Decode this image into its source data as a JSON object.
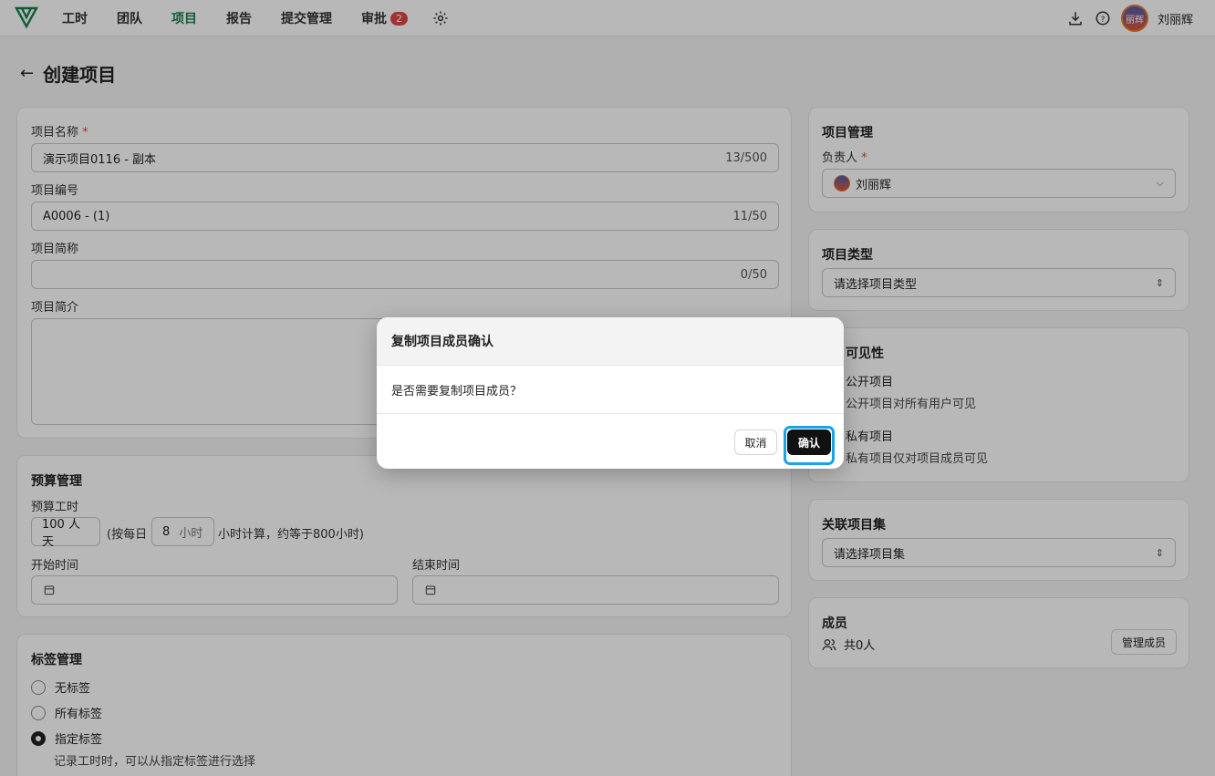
{
  "nav": {
    "items": [
      {
        "label": "工时"
      },
      {
        "label": "团队"
      },
      {
        "label": "项目"
      },
      {
        "label": "报告"
      },
      {
        "label": "提交管理"
      },
      {
        "label": "审批"
      }
    ],
    "approval_badge": "2",
    "active": "项目",
    "user_name": "刘丽辉",
    "avatar_text": "丽辉"
  },
  "page": {
    "title": "创建项目"
  },
  "basic": {
    "name_label": "项目名称",
    "name_value": "演示项目0116 - 副本",
    "name_counter": "13/500",
    "code_label": "项目编号",
    "code_value": "A0006 - (1)",
    "code_counter": "11/50",
    "short_label": "项目简称",
    "short_counter": "0/50",
    "intro_label": "项目简介"
  },
  "budget": {
    "title": "预算管理",
    "hours_label": "预算工时",
    "days_value": "100 人天",
    "per_day_prefix": "(按每日",
    "per_day_value": "8",
    "per_day_unit": "小时",
    "per_day_suffix": "小时计算，约等于800小时)",
    "start_label": "开始时间",
    "end_label": "结束时间"
  },
  "tags": {
    "title": "标签管理",
    "options": [
      "无标签",
      "所有标签",
      "指定标签"
    ],
    "hint": "记录工时时，可以从指定标签进行选择"
  },
  "management": {
    "title": "项目管理",
    "owner_label": "负责人",
    "owner_value": "刘丽辉"
  },
  "type": {
    "title": "项目类型",
    "placeholder": "请选择项目类型"
  },
  "visibility": {
    "title": "可见性",
    "public_label": "公开项目",
    "public_desc": "公开项目对所有用户可见",
    "private_label": "私有项目",
    "private_desc": "私有项目仅对项目成员可见"
  },
  "collection": {
    "title": "关联项目集",
    "placeholder": "请选择项目集"
  },
  "members": {
    "title": "成员",
    "count": "共0人",
    "manage_label": "管理成员"
  },
  "dialog": {
    "title": "复制项目成员确认",
    "message": "是否需要复制项目成员？",
    "cancel_label": "取消",
    "confirm_label": "确认"
  }
}
